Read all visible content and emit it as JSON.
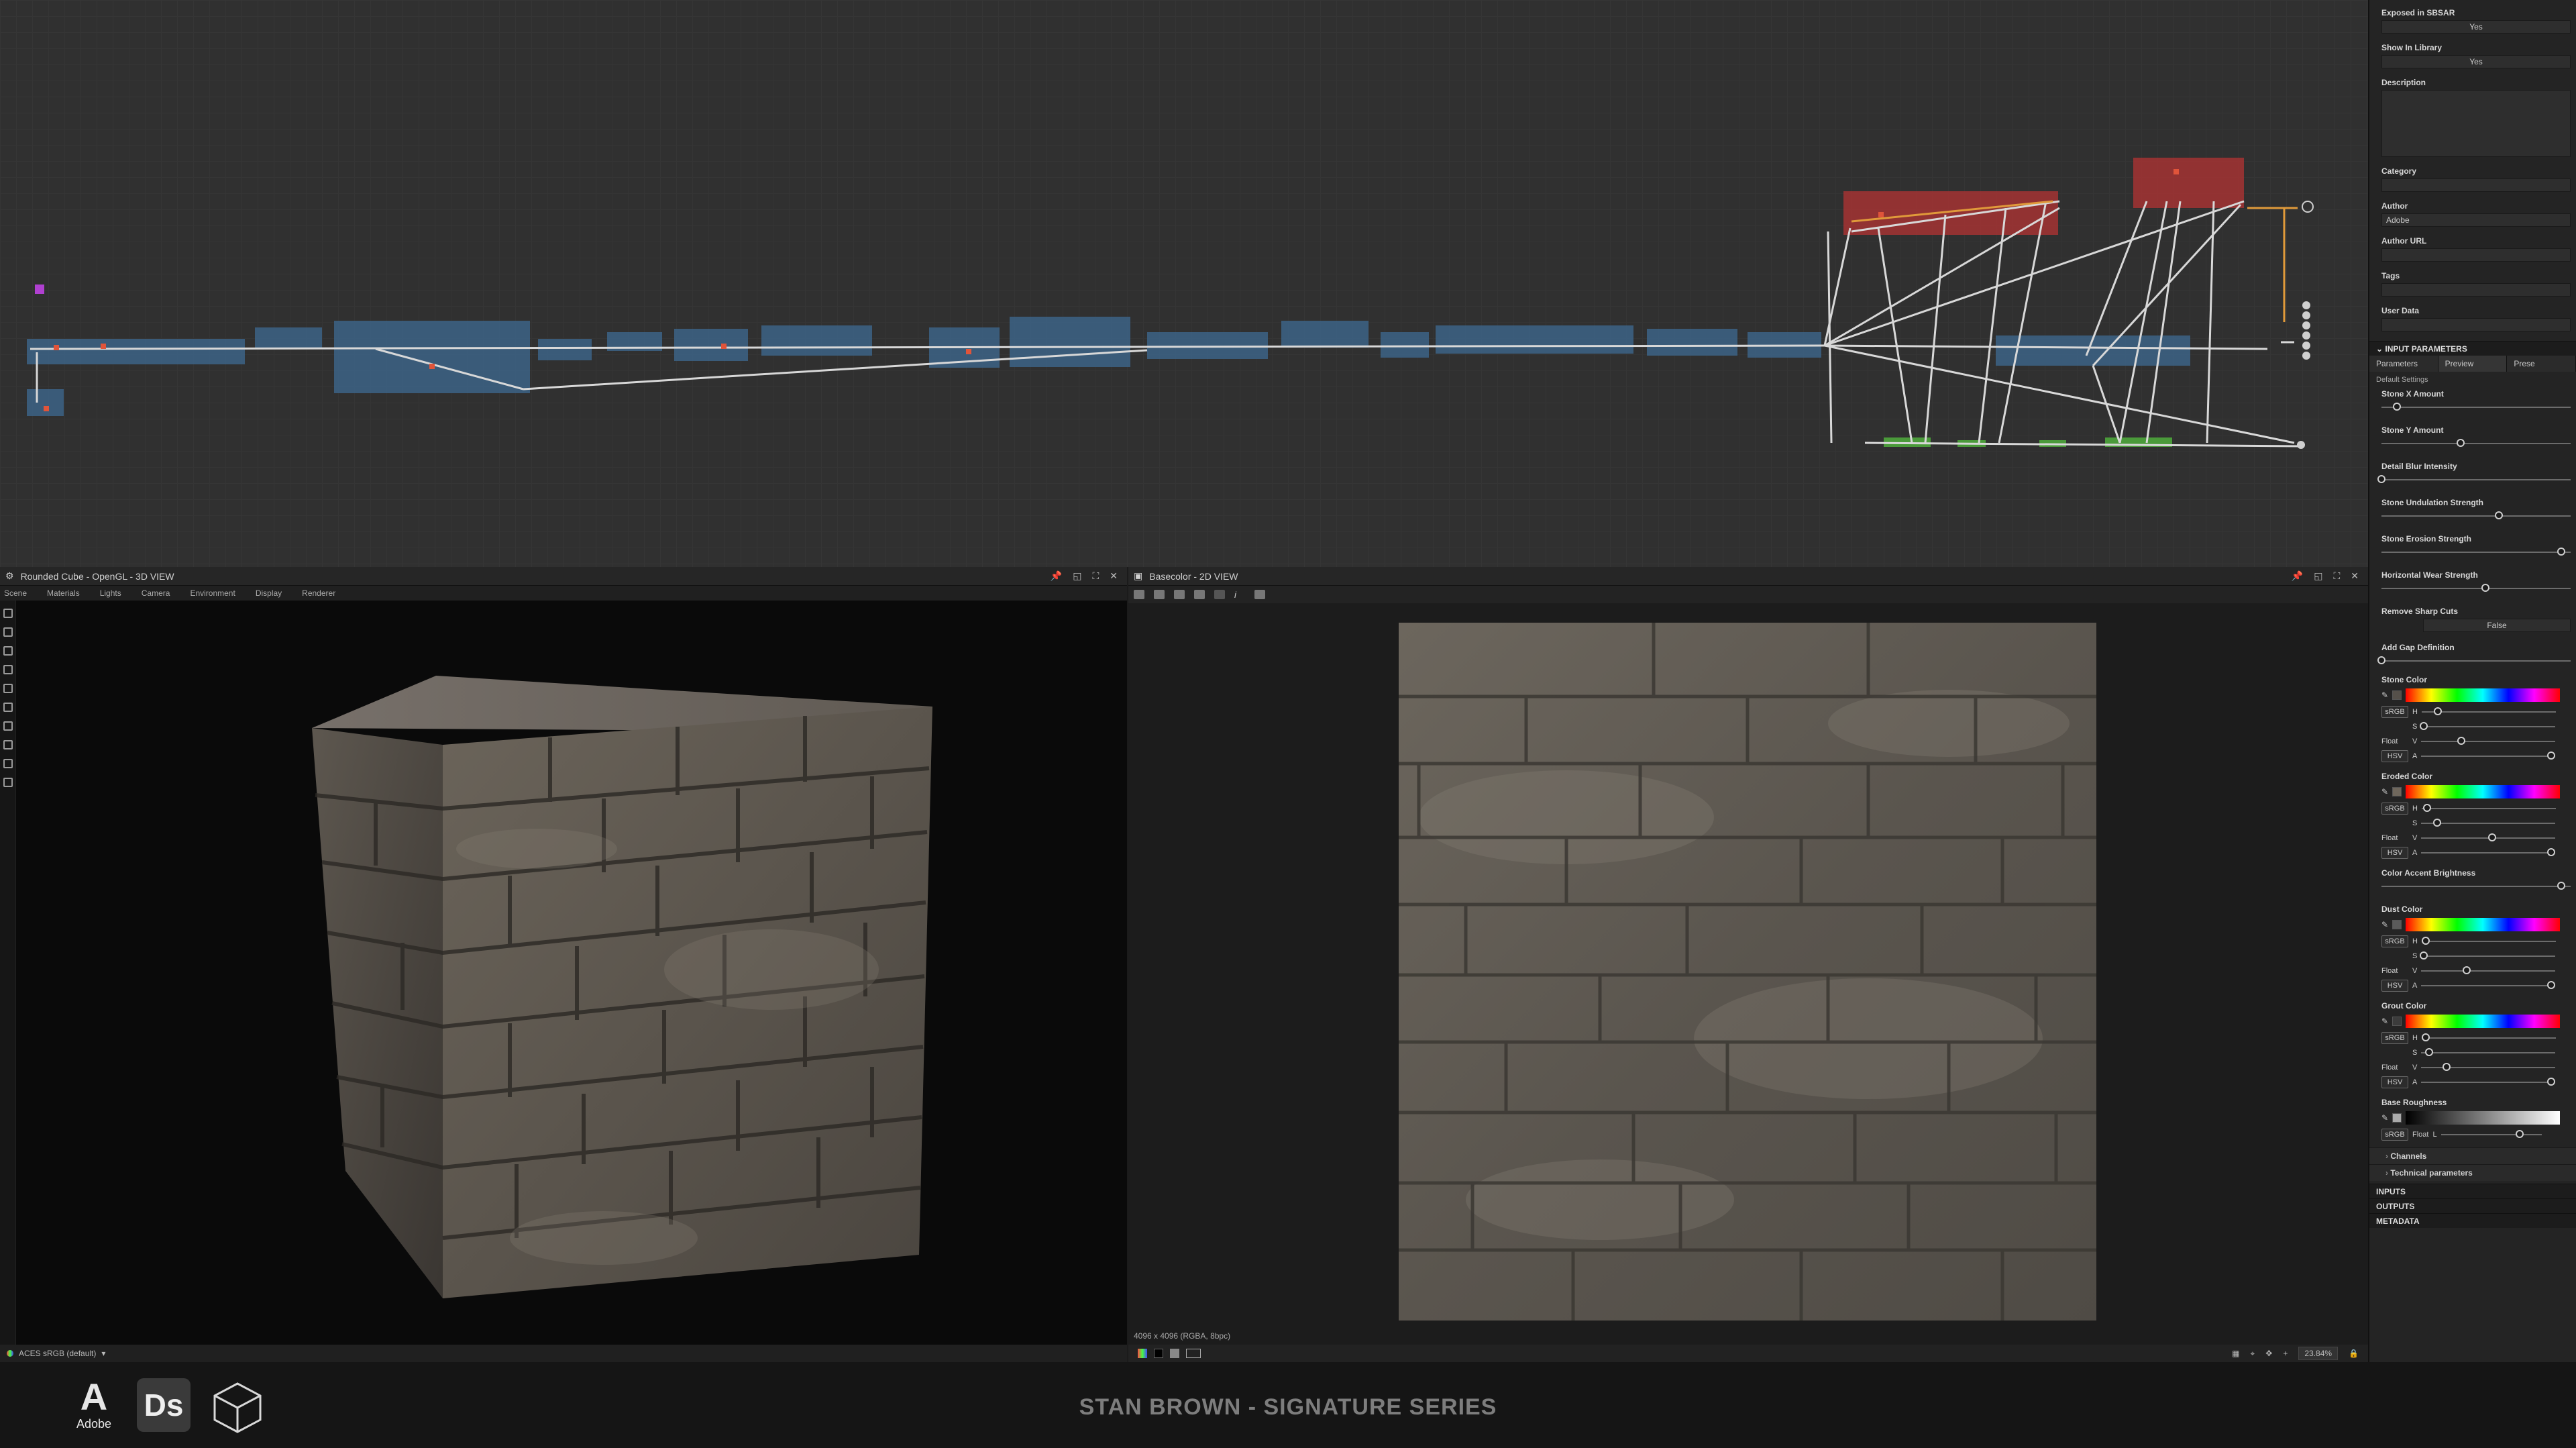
{
  "viewport3d": {
    "title": "Rounded Cube - OpenGL - 3D VIEW",
    "menu": [
      "Scene",
      "Materials",
      "Lights",
      "Camera",
      "Environment",
      "Display",
      "Renderer"
    ],
    "colorspace": "ACES sRGB (default)"
  },
  "viewport2d": {
    "title": "Basecolor - 2D VIEW",
    "info": "4096 x 4096 (RGBA, 8bpc)",
    "zoom": "23.84%"
  },
  "properties": {
    "exposed_label": "Exposed in SBSAR",
    "exposed_value": "Yes",
    "library_label": "Show In Library",
    "library_value": "Yes",
    "description_label": "Description",
    "category_label": "Category",
    "author_label": "Author",
    "author_value": "Adobe",
    "author_url_label": "Author URL",
    "tags_label": "Tags",
    "user_data_label": "User Data",
    "input_params_header": "INPUT PARAMETERS",
    "tabs": [
      "Parameters",
      "Preview",
      "Prese"
    ],
    "default_settings": "Default Settings",
    "params": [
      {
        "label": "Stone X Amount",
        "value": 0.08
      },
      {
        "label": "Stone Y Amount",
        "value": 0.42
      },
      {
        "label": "Detail Blur Intensity",
        "value": 0.0
      },
      {
        "label": "Stone Undulation Strength",
        "value": 0.62
      },
      {
        "label": "Stone Erosion Strength",
        "value": 0.95
      },
      {
        "label": "Horizontal Wear Strength",
        "value": 0.55
      }
    ],
    "remove_sharp_label": "Remove Sharp Cuts",
    "remove_sharp_value": "False",
    "gap_def_label": "Add Gap Definition",
    "gap_def_value": 0.0,
    "accent_label": "Color Accent Brightness",
    "accent_value": 0.95,
    "colors": [
      {
        "label": "Stone Color",
        "swatch": "#55504a",
        "h": 0.12,
        "s": 0.02,
        "v": 0.3,
        "a": 0.97
      },
      {
        "label": "Eroded Color",
        "swatch": "#6f675c",
        "h": 0.04,
        "s": 0.12,
        "v": 0.53,
        "a": 0.97
      },
      {
        "label": "Dust Color",
        "swatch": "#5a5a5a",
        "h": 0.03,
        "s": 0.02,
        "v": 0.34,
        "a": 0.97
      },
      {
        "label": "Grout Color",
        "swatch": "#3c3c3c",
        "h": 0.03,
        "s": 0.06,
        "v": 0.19,
        "a": 0.97
      }
    ],
    "base_roughness_label": "Base Roughness",
    "base_roughness_value": 0.78,
    "btn_srgb": "sRGB",
    "btn_float": "Float",
    "btn_hsv": "HSV",
    "lbl_h": "H",
    "lbl_s": "S",
    "lbl_v": "V",
    "lbl_a": "A",
    "lbl_l": "L",
    "channels": "Channels",
    "technical": "Technical parameters",
    "inputs": "INPUTS",
    "outputs": "OUTPUTS",
    "metadata": "METADATA"
  },
  "branding": {
    "adobe_text": "Adobe",
    "ds_text": "Ds",
    "title": "STAN BROWN - SIGNATURE SERIES"
  }
}
